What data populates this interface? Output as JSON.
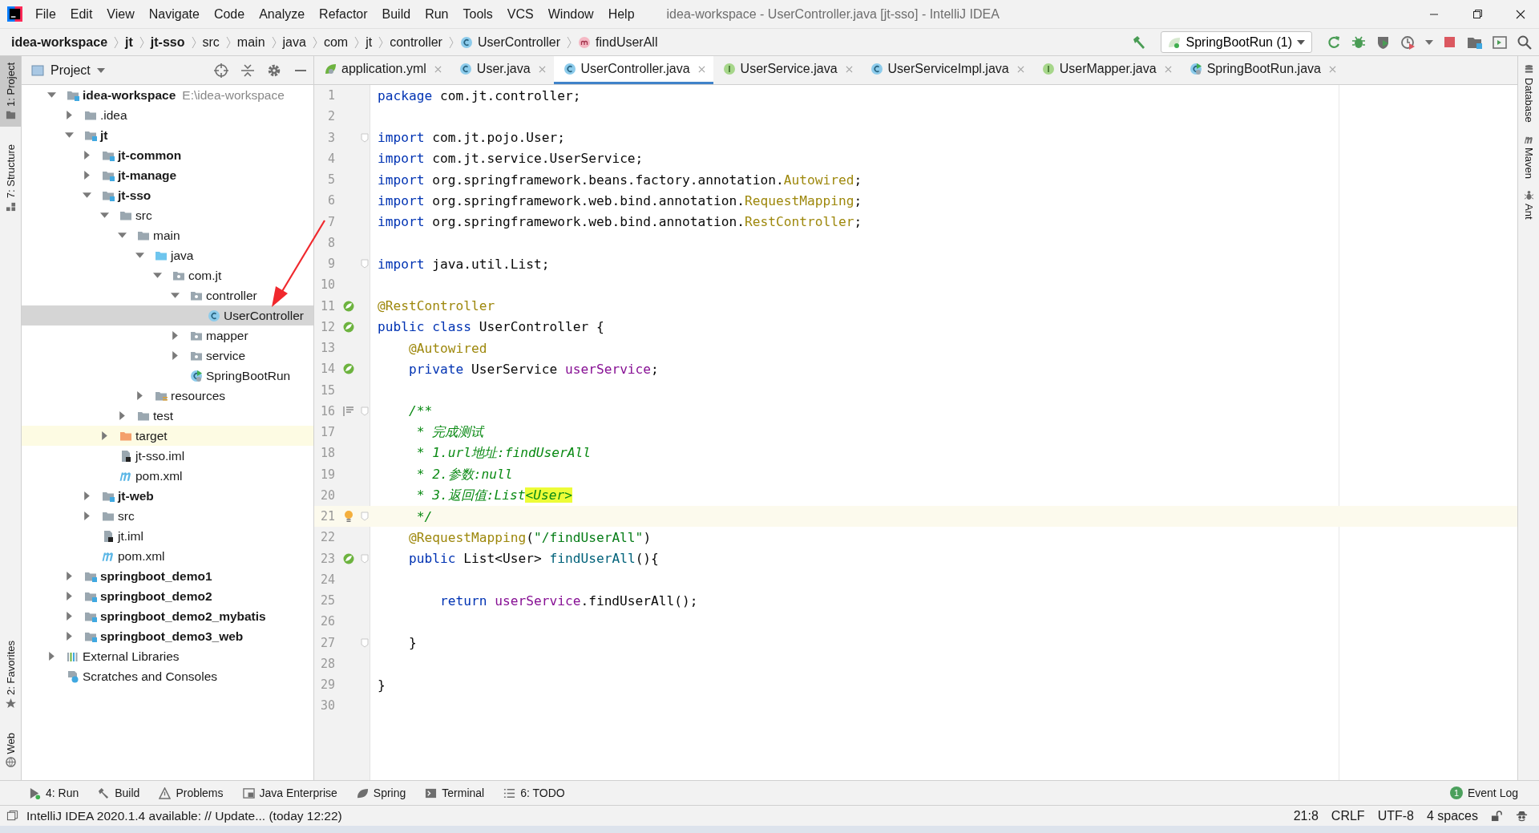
{
  "window": {
    "title": "idea-workspace - UserController.java [jt-sso] - IntelliJ IDEA"
  },
  "menu": [
    "File",
    "Edit",
    "View",
    "Navigate",
    "Code",
    "Analyze",
    "Refactor",
    "Build",
    "Run",
    "Tools",
    "VCS",
    "Window",
    "Help"
  ],
  "breadcrumbs": [
    {
      "label": "idea-workspace",
      "kind": "module"
    },
    {
      "label": "jt",
      "kind": "module"
    },
    {
      "label": "jt-sso",
      "kind": "module"
    },
    {
      "label": "src",
      "kind": "folder"
    },
    {
      "label": "main",
      "kind": "folder"
    },
    {
      "label": "java",
      "kind": "folder"
    },
    {
      "label": "com",
      "kind": "folder"
    },
    {
      "label": "jt",
      "kind": "folder"
    },
    {
      "label": "controller",
      "kind": "folder"
    },
    {
      "label": "UserController",
      "kind": "class"
    },
    {
      "label": "findUserAll",
      "kind": "method"
    }
  ],
  "run_config": {
    "label": "SpringBootRun (1)"
  },
  "left_strip": {
    "top": [
      {
        "label": "1: Project",
        "kind": "project",
        "selected": true
      },
      {
        "label": "7: Structure",
        "kind": "structure",
        "selected": false
      }
    ],
    "bottom": [
      {
        "label": "2: Favorites",
        "kind": "favorites",
        "selected": false
      },
      {
        "label": "Web",
        "kind": "web",
        "selected": false
      }
    ]
  },
  "right_strip": [
    {
      "label": "Database",
      "kind": "database"
    },
    {
      "label": "Maven",
      "kind": "maven"
    },
    {
      "label": "Ant",
      "kind": "ant"
    }
  ],
  "project": {
    "title": "Project",
    "tree": [
      {
        "label": "idea-workspace",
        "secondary": "E:\\idea-workspace",
        "kind": "module",
        "bold": true,
        "expanded": true,
        "selected": false,
        "children": [
          {
            "label": ".idea",
            "kind": "folder",
            "bold": false,
            "expanded": false,
            "selected": false
          },
          {
            "label": "jt",
            "kind": "module",
            "bold": true,
            "expanded": true,
            "selected": false,
            "children": [
              {
                "label": "jt-common",
                "kind": "module",
                "bold": true,
                "expanded": false,
                "selected": false
              },
              {
                "label": "jt-manage",
                "kind": "module",
                "bold": true,
                "expanded": false,
                "selected": false
              },
              {
                "label": "jt-sso",
                "kind": "module",
                "bold": true,
                "expanded": true,
                "selected": false,
                "children": [
                  {
                    "label": "src",
                    "kind": "folder",
                    "bold": false,
                    "expanded": true,
                    "selected": false,
                    "children": [
                      {
                        "label": "main",
                        "kind": "folder",
                        "bold": false,
                        "expanded": true,
                        "selected": false,
                        "children": [
                          {
                            "label": "java",
                            "kind": "source-folder",
                            "bold": false,
                            "expanded": true,
                            "selected": false,
                            "children": [
                              {
                                "label": "com.jt",
                                "kind": "package",
                                "bold": false,
                                "expanded": true,
                                "selected": false,
                                "children": [
                                  {
                                    "label": "controller",
                                    "kind": "package",
                                    "bold": false,
                                    "expanded": true,
                                    "selected": false,
                                    "children": [
                                      {
                                        "label": "UserController",
                                        "kind": "class",
                                        "bold": false,
                                        "selected": true
                                      }
                                    ]
                                  },
                                  {
                                    "label": "mapper",
                                    "kind": "package",
                                    "bold": false,
                                    "expanded": false,
                                    "selected": false
                                  },
                                  {
                                    "label": "service",
                                    "kind": "package",
                                    "bold": false,
                                    "expanded": false,
                                    "selected": false
                                  },
                                  {
                                    "label": "SpringBootRun",
                                    "kind": "run-class",
                                    "bold": false,
                                    "selected": false
                                  }
                                ]
                              }
                            ]
                          },
                          {
                            "label": "resources",
                            "kind": "resources-folder",
                            "bold": false,
                            "expanded": false,
                            "selected": false
                          }
                        ]
                      },
                      {
                        "label": "test",
                        "kind": "folder",
                        "bold": false,
                        "expanded": false,
                        "selected": false
                      }
                    ]
                  },
                  {
                    "label": "target",
                    "kind": "excluded-folder",
                    "bold": false,
                    "expanded": false,
                    "selected": false
                  },
                  {
                    "label": "jt-sso.iml",
                    "kind": "iml",
                    "bold": false,
                    "selected": false
                  },
                  {
                    "label": "pom.xml",
                    "kind": "maven",
                    "bold": false,
                    "selected": false
                  }
                ]
              },
              {
                "label": "jt-web",
                "kind": "module",
                "bold": true,
                "expanded": false,
                "selected": false
              },
              {
                "label": "src",
                "kind": "folder",
                "bold": false,
                "expanded": false,
                "selected": false
              },
              {
                "label": "jt.iml",
                "kind": "iml",
                "bold": false,
                "selected": false
              },
              {
                "label": "pom.xml",
                "kind": "maven",
                "bold": false,
                "selected": false
              }
            ]
          },
          {
            "label": "springboot_demo1",
            "kind": "module",
            "bold": true,
            "expanded": false,
            "selected": false
          },
          {
            "label": "springboot_demo2",
            "kind": "module",
            "bold": true,
            "expanded": false,
            "selected": false
          },
          {
            "label": "springboot_demo2_mybatis",
            "kind": "module",
            "bold": true,
            "expanded": false,
            "selected": false
          },
          {
            "label": "springboot_demo3_web",
            "kind": "module",
            "bold": true,
            "expanded": false,
            "selected": false
          }
        ]
      },
      {
        "label": "External Libraries",
        "kind": "libraries",
        "bold": false,
        "expanded": false,
        "selected": false
      },
      {
        "label": "Scratches and Consoles",
        "kind": "scratches",
        "bold": false,
        "selected": false
      }
    ]
  },
  "tabs": [
    {
      "label": "application.yml",
      "kind": "yml",
      "selected": false
    },
    {
      "label": "User.java",
      "kind": "class",
      "selected": false
    },
    {
      "label": "UserController.java",
      "kind": "class",
      "selected": true
    },
    {
      "label": "UserService.java",
      "kind": "interface",
      "selected": false
    },
    {
      "label": "UserServiceImpl.java",
      "kind": "class",
      "selected": false
    },
    {
      "label": "UserMapper.java",
      "kind": "interface",
      "selected": false
    },
    {
      "label": "SpringBootRun.java",
      "kind": "run-class",
      "selected": false
    }
  ],
  "editor": {
    "lines": [
      {
        "number": "1",
        "tokens": [
          {
            "text": "package",
            "kind": "kw"
          },
          {
            "text": " com.jt.controller;",
            "kind": "plain"
          }
        ]
      },
      {
        "number": "2"
      },
      {
        "number": "3",
        "fold": true,
        "tokens": [
          {
            "text": "import",
            "kind": "kw"
          },
          {
            "text": " com.jt.pojo.User;",
            "kind": "plain"
          }
        ]
      },
      {
        "number": "4",
        "tokens": [
          {
            "text": "import",
            "kind": "kw"
          },
          {
            "text": " com.jt.service.UserService;",
            "kind": "plain"
          }
        ]
      },
      {
        "number": "5",
        "tokens": [
          {
            "text": "import",
            "kind": "kw"
          },
          {
            "text": " org.springframework.beans.factory.annotation.",
            "kind": "plain"
          },
          {
            "text": "Autowired",
            "kind": "ann"
          },
          {
            "text": ";",
            "kind": "plain"
          }
        ]
      },
      {
        "number": "6",
        "tokens": [
          {
            "text": "import",
            "kind": "kw"
          },
          {
            "text": " org.springframework.web.bind.annotation.",
            "kind": "plain"
          },
          {
            "text": "RequestMapping",
            "kind": "ann"
          },
          {
            "text": ";",
            "kind": "plain"
          }
        ]
      },
      {
        "number": "7",
        "tokens": [
          {
            "text": "import",
            "kind": "kw"
          },
          {
            "text": " org.springframework.web.bind.annotation.",
            "kind": "plain"
          },
          {
            "text": "RestController",
            "kind": "ann"
          },
          {
            "text": ";",
            "kind": "plain"
          }
        ]
      },
      {
        "number": "8"
      },
      {
        "number": "9",
        "fold": true,
        "tokens": [
          {
            "text": "import",
            "kind": "kw"
          },
          {
            "text": " java.util.List;",
            "kind": "plain"
          }
        ]
      },
      {
        "number": "10"
      },
      {
        "number": "11",
        "kind": "spring",
        "tokens": [
          {
            "text": "@RestController",
            "kind": "ann"
          }
        ]
      },
      {
        "number": "12",
        "kind": "spring",
        "tokens": [
          {
            "text": "public class",
            "kind": "kw"
          },
          {
            "text": " UserController {",
            "kind": "plain"
          }
        ]
      },
      {
        "number": "13",
        "tokens": [
          {
            "text": "    @Autowired",
            "kind": "ann"
          }
        ]
      },
      {
        "number": "14",
        "kind": "spring",
        "tokens": [
          {
            "text": "    private",
            "kind": "kw"
          },
          {
            "text": " UserService ",
            "kind": "plain"
          },
          {
            "text": "userService",
            "kind": "field"
          },
          {
            "text": ";",
            "kind": "plain"
          }
        ]
      },
      {
        "number": "15"
      },
      {
        "number": "16",
        "kind": "doc",
        "fold": true,
        "tokens": [
          {
            "text": "    /**",
            "kind": "comment"
          }
        ]
      },
      {
        "number": "17",
        "tokens": [
          {
            "text": "     * 完成测试",
            "kind": "comment"
          }
        ]
      },
      {
        "number": "18",
        "tokens": [
          {
            "text": "     * 1.url地址:findUserAll",
            "kind": "comment"
          }
        ]
      },
      {
        "number": "19",
        "tokens": [
          {
            "text": "     * 2.参数:null",
            "kind": "comment"
          }
        ]
      },
      {
        "number": "20",
        "tokens": [
          {
            "text": "     * 3.返回值:List",
            "kind": "comment"
          },
          {
            "text": "<User>",
            "kind": "highlight"
          }
        ]
      },
      {
        "number": "21",
        "kind": "bulb",
        "fold": true,
        "current": true,
        "tokens": [
          {
            "text": "     */",
            "kind": "comment"
          }
        ]
      },
      {
        "number": "22",
        "tokens": [
          {
            "text": "    @RequestMapping",
            "kind": "ann"
          },
          {
            "text": "(",
            "kind": "plain"
          },
          {
            "text": "\"/findUserAll\"",
            "kind": "string"
          },
          {
            "text": ")",
            "kind": "plain"
          }
        ]
      },
      {
        "number": "23",
        "kind": "spring",
        "fold": true,
        "tokens": [
          {
            "text": "    public",
            "kind": "kw"
          },
          {
            "text": " List<User> ",
            "kind": "plain"
          },
          {
            "text": "findUserAll",
            "kind": "method"
          },
          {
            "text": "(){",
            "kind": "plain"
          }
        ]
      },
      {
        "number": "24"
      },
      {
        "number": "25",
        "tokens": [
          {
            "text": "        return ",
            "kind": "kw"
          },
          {
            "text": "userService",
            "kind": "field"
          },
          {
            "text": ".findUserAll();",
            "kind": "plain"
          }
        ]
      },
      {
        "number": "26"
      },
      {
        "number": "27",
        "fold": true,
        "tokens": [
          {
            "text": "    }",
            "kind": "plain"
          }
        ]
      },
      {
        "number": "28"
      },
      {
        "number": "29",
        "tokens": [
          {
            "text": "}",
            "kind": "plain"
          }
        ]
      },
      {
        "number": "30"
      }
    ]
  },
  "tool_buttons": [
    {
      "label": "4: Run",
      "kind": "run"
    },
    {
      "label": "Build",
      "kind": "build"
    },
    {
      "label": "Problems",
      "kind": "problems"
    },
    {
      "label": "Java Enterprise",
      "kind": "enterprise"
    },
    {
      "label": "Spring",
      "kind": "spring"
    },
    {
      "label": "Terminal",
      "kind": "terminal"
    },
    {
      "label": "6: TODO",
      "kind": "todo"
    }
  ],
  "event_log": {
    "label": "Event Log",
    "count": "1"
  },
  "status_bar": {
    "message": "IntelliJ IDEA 2020.1.4 available: // Update... (today 12:22)",
    "position": "21:8",
    "line_separator": "CRLF",
    "encoding": "UTF-8",
    "indent": "4 spaces"
  }
}
